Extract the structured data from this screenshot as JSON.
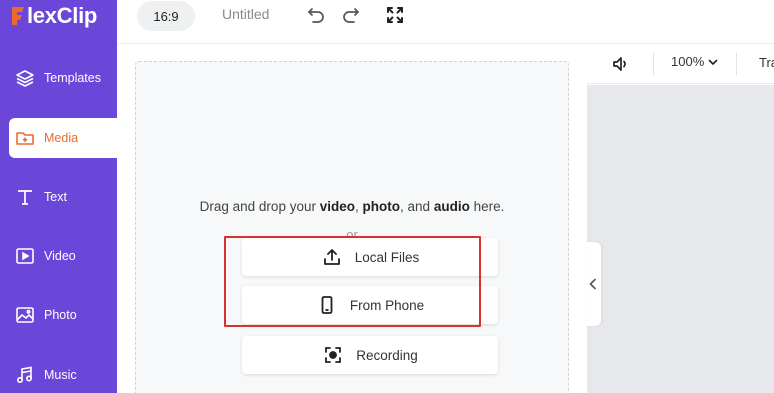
{
  "brand": {
    "logo_text": "lexClip",
    "logo_letter": "F",
    "primary_color": "#6a47d8",
    "accent_color": "#ed6a2e"
  },
  "sidebar": {
    "items": [
      {
        "label": "Templates",
        "icon": "layers-icon"
      },
      {
        "label": "Media",
        "icon": "folder-plus-icon",
        "active": true
      },
      {
        "label": "Text",
        "icon": "text-t-icon"
      },
      {
        "label": "Video",
        "icon": "video-play-icon"
      },
      {
        "label": "Photo",
        "icon": "photo-icon"
      },
      {
        "label": "Music",
        "icon": "music-note-icon"
      }
    ]
  },
  "topbar": {
    "aspect_ratio": "16:9",
    "project_title": "Untitled",
    "icons": [
      "undo-icon",
      "redo-icon",
      "fullscreen-icon"
    ]
  },
  "media_panel": {
    "drag_text": {
      "prefix": "Drag and drop your",
      "video": "video",
      "sep1": ",",
      "photo": "photo",
      "sep2": ", and",
      "audio": "audio",
      "suffix": "here."
    },
    "or_text": "or",
    "buttons": [
      {
        "label": "Local Files",
        "icon": "upload-icon"
      },
      {
        "label": "From Phone",
        "icon": "phone-icon"
      },
      {
        "label": "Recording",
        "icon": "record-icon"
      }
    ],
    "highlight_color": "#d9312f"
  },
  "preview_toolbar": {
    "volume_icon": "volume-icon",
    "zoom": "100%",
    "trim_label": "Tra"
  }
}
